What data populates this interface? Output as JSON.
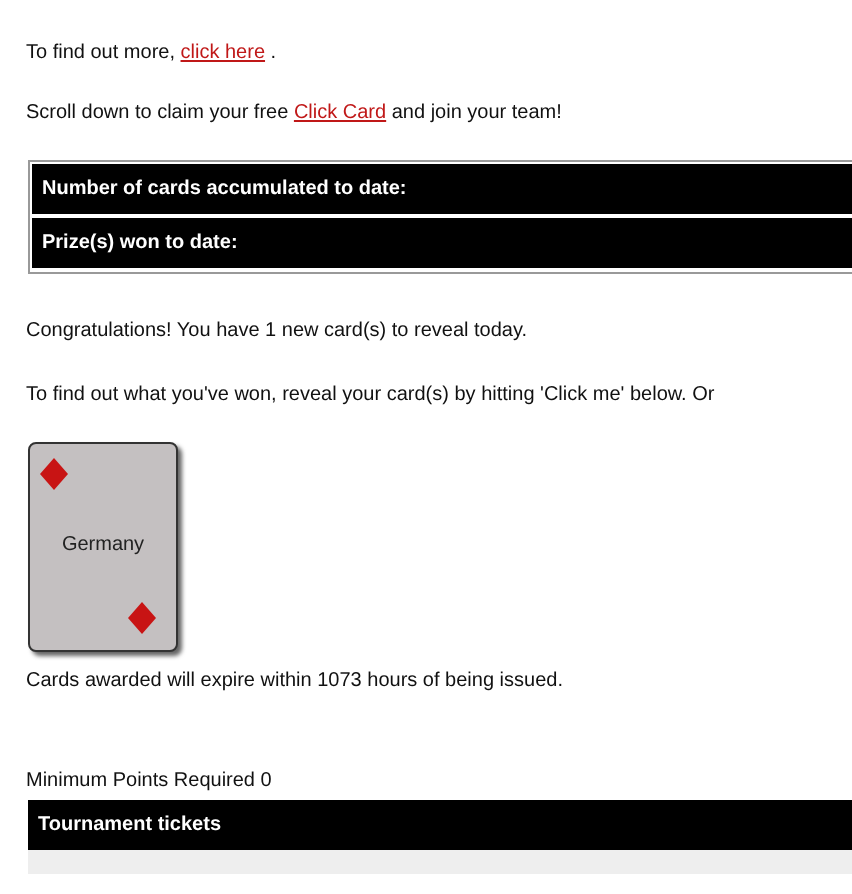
{
  "intro": {
    "before": "To find out more, ",
    "link": "click here",
    "after": " ."
  },
  "claim": {
    "before": "Scroll down to claim your free ",
    "link": "Click Card",
    "after": " and join your team!"
  },
  "stats": [
    "Number of cards accumulated to date:",
    "Prize(s) won to date:"
  ],
  "congrats": "Congratulations! You have 1 new card(s) to reveal today.",
  "instructions": "To find out what you've won, reveal your card(s) by hitting 'Click me' below. Or",
  "cards": [
    {
      "label": "Germany"
    }
  ],
  "expiry": "Cards awarded will expire within 1073 hours of being issued.",
  "minimum": "Minimum Points Required 0",
  "prize_table": {
    "header": "Tournament tickets"
  }
}
